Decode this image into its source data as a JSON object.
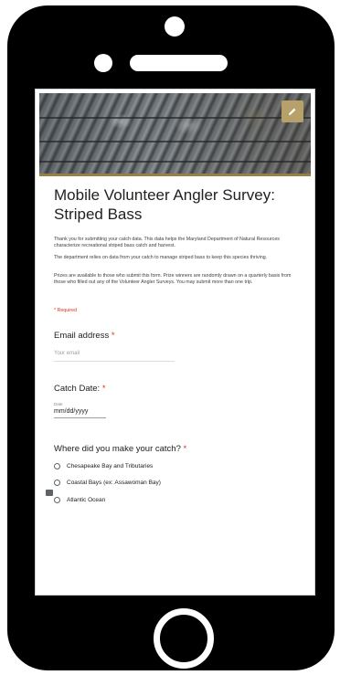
{
  "form": {
    "title": "Mobile Volunteer Angler Survey: Striped Bass",
    "description_1": "Thank you for submitting your catch data. This data helps the Maryland Department of Natural Resources characterize recreational striped bass catch and harvest.",
    "description_2": "The department relies on data from your catch to manage striped bass to keep this species thriving.",
    "description_3": "Prizes are available to those who submit this form. Prize winners are randomly drawn on a quarterly basis from those who filled out any of the Volunteer Angler Surveys. You may submit more than one trip.",
    "required_note": "* Required"
  },
  "email": {
    "label": "Email address",
    "required_star": "*",
    "placeholder": "Your email"
  },
  "catch_date": {
    "label": "Catch Date:",
    "required_star": "*",
    "small_label": "Date",
    "value": "mm/dd/yyyy"
  },
  "location": {
    "label": "Where did you make your catch?",
    "required_star": "*",
    "options": [
      "Chesapeake Bay and Tributaries",
      "Coastal Bays (ex: Assawoman Bay)",
      "Atlantic Ocean"
    ]
  },
  "icons": {
    "edit": "pencil-icon",
    "feedback": "feedback-icon"
  },
  "colors": {
    "accent": "#9a7f45",
    "edit_button": "#b8a06a",
    "required": "#d93025"
  }
}
